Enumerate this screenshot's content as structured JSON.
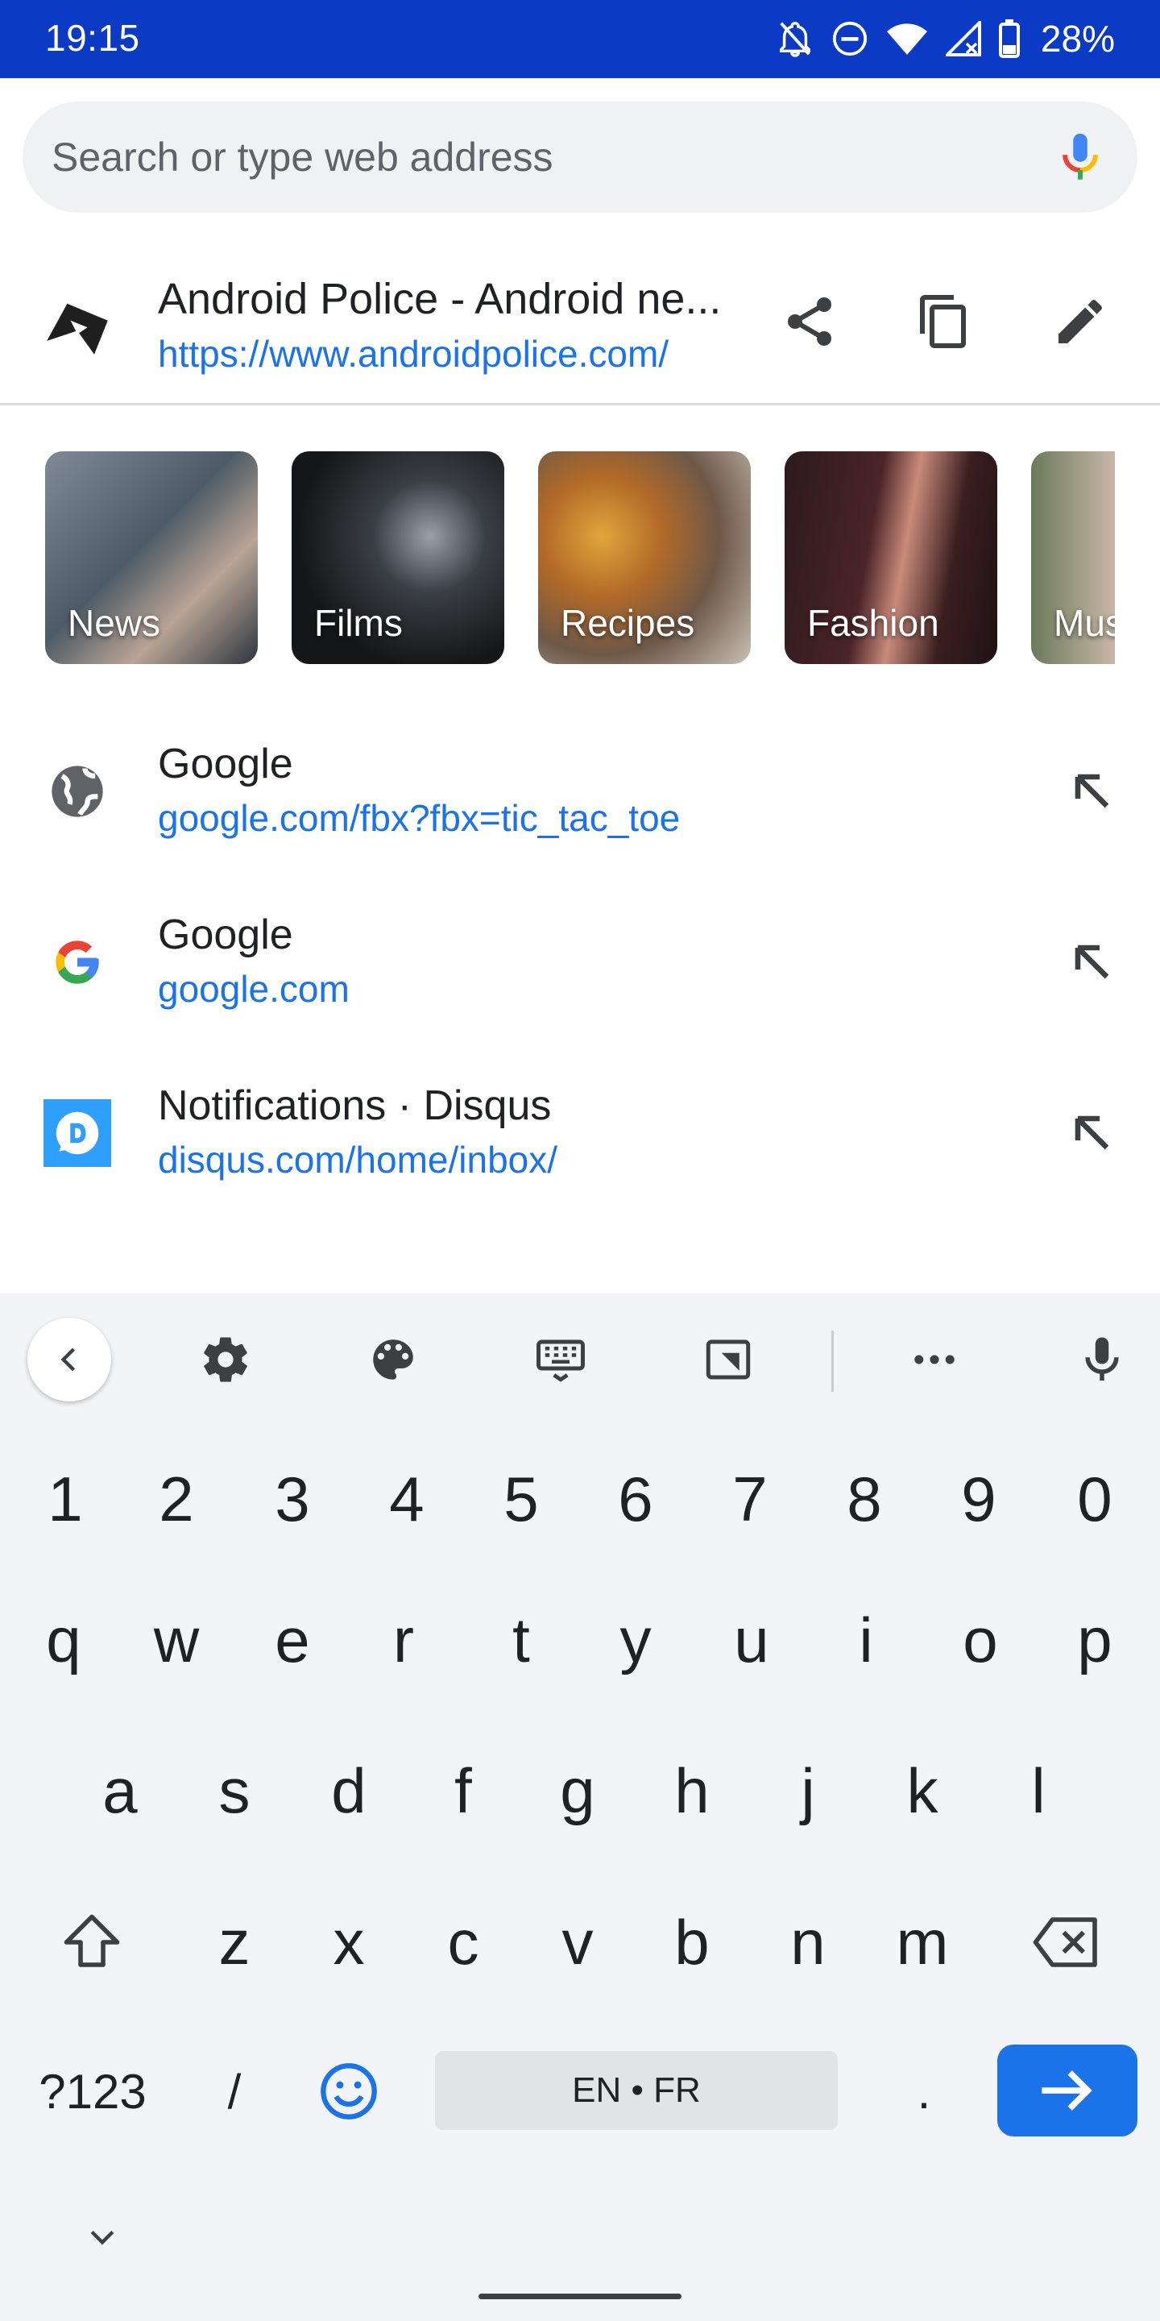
{
  "status_bar": {
    "time": "19:15",
    "battery": "28%",
    "icons": [
      "notifications-off-icon",
      "do-not-disturb-icon",
      "wifi-icon",
      "cellular-icon",
      "battery-icon"
    ]
  },
  "omnibox": {
    "placeholder": "Search or type web address",
    "value": ""
  },
  "current_page": {
    "title": "Android Police - Android ne...",
    "url": "https://www.androidpolice.com/",
    "actions": [
      "share-icon",
      "copy-icon",
      "edit-icon"
    ]
  },
  "tiles": [
    {
      "label": "News"
    },
    {
      "label": "Films"
    },
    {
      "label": "Recipes"
    },
    {
      "label": "Fashion"
    },
    {
      "label": "Mus"
    }
  ],
  "suggestions": [
    {
      "title": "Google",
      "url": "google.com/fbx?fbx=tic_tac_toe",
      "icon": "globe-icon"
    },
    {
      "title": "Google",
      "url": "google.com",
      "icon": "google-g-icon"
    },
    {
      "title": "Notifications · Disqus",
      "url": "disqus.com/home/inbox/",
      "icon": "disqus-icon"
    }
  ],
  "keyboard": {
    "number_row": [
      "1",
      "2",
      "3",
      "4",
      "5",
      "6",
      "7",
      "8",
      "9",
      "0"
    ],
    "row1": [
      "q",
      "w",
      "e",
      "r",
      "t",
      "y",
      "u",
      "i",
      "o",
      "p"
    ],
    "row2": [
      "a",
      "s",
      "d",
      "f",
      "g",
      "h",
      "j",
      "k",
      "l"
    ],
    "row3": [
      "z",
      "x",
      "c",
      "v",
      "b",
      "n",
      "m"
    ],
    "symbols_key": "?123",
    "slash_key": "/",
    "space_label": "EN • FR",
    "period_key": "."
  },
  "colors": {
    "status_bar": "#0b3bc4",
    "link": "#1a73e8",
    "keyboard_bg": "#f2f4f7",
    "enter_key": "#1a73e8"
  }
}
